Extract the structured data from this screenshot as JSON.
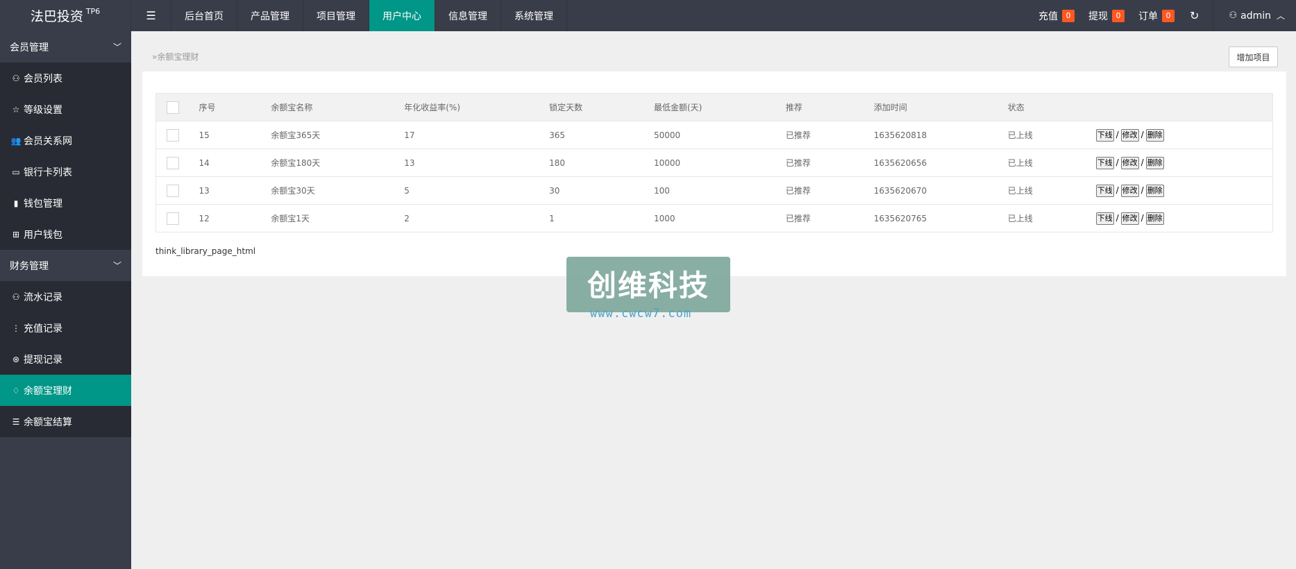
{
  "brand": {
    "name": "法巴投资",
    "tag": "TP6"
  },
  "menu_toggle_icon": "hamburger-icon",
  "nav": [
    {
      "label": "后台首页",
      "active": false
    },
    {
      "label": "产品管理",
      "active": false
    },
    {
      "label": "项目管理",
      "active": false
    },
    {
      "label": "用户中心",
      "active": true
    },
    {
      "label": "信息管理",
      "active": false
    },
    {
      "label": "系统管理",
      "active": false
    }
  ],
  "top_right": {
    "recharge": {
      "label": "充值",
      "count": "0"
    },
    "withdraw": {
      "label": "提现",
      "count": "0"
    },
    "order": {
      "label": "订单",
      "count": "0"
    },
    "user": "admin"
  },
  "sidebar": {
    "groups": [
      {
        "title": "会员管理",
        "items": [
          {
            "label": "会员列表",
            "icon": "user-icon"
          },
          {
            "label": "等级设置",
            "icon": "star-icon"
          },
          {
            "label": "会员关系网",
            "icon": "users-icon"
          },
          {
            "label": "银行卡列表",
            "icon": "card-icon"
          },
          {
            "label": "钱包管理",
            "icon": "book-icon"
          },
          {
            "label": "用户钱包",
            "icon": "wallet-icon"
          }
        ]
      },
      {
        "title": "财务管理",
        "items": [
          {
            "label": "流水记录",
            "icon": "user-icon"
          },
          {
            "label": "充值记录",
            "icon": "dots-icon"
          },
          {
            "label": "提现记录",
            "icon": "yen-icon"
          },
          {
            "label": "余额宝理财",
            "icon": "diamond-icon",
            "active": true
          },
          {
            "label": "余额宝结算",
            "icon": "list-icon"
          }
        ]
      }
    ]
  },
  "breadcrumb": "余额宝理财",
  "add_button": "增加项目",
  "table": {
    "headers": [
      "序号",
      "余额宝名称",
      "年化收益率(%)",
      "锁定天数",
      "最低金额(天)",
      "推荐",
      "添加时间",
      "状态"
    ],
    "rows": [
      {
        "id": "15",
        "name": "余额宝365天",
        "rate": "17",
        "days": "365",
        "min": "50000",
        "recommend": "已推荐",
        "time": "1635620818",
        "status": "已上线"
      },
      {
        "id": "14",
        "name": "余额宝180天",
        "rate": "13",
        "days": "180",
        "min": "10000",
        "recommend": "已推荐",
        "time": "1635620656",
        "status": "已上线"
      },
      {
        "id": "13",
        "name": "余额宝30天",
        "rate": "5",
        "days": "30",
        "min": "100",
        "recommend": "已推荐",
        "time": "1635620670",
        "status": "已上线"
      },
      {
        "id": "12",
        "name": "余额宝1天",
        "rate": "2",
        "days": "1",
        "min": "1000",
        "recommend": "已推荐",
        "time": "1635620765",
        "status": "已上线"
      }
    ],
    "actions": [
      "下线",
      "修改",
      "删除"
    ]
  },
  "pager_text": "think_library_page_html",
  "watermark": {
    "title": "创维科技",
    "url": "www.cwcw7.com"
  },
  "colors": {
    "topbar": "#393d49",
    "accent": "#009688",
    "badge": "#ff5722",
    "sidebar_item": "#282b33"
  }
}
